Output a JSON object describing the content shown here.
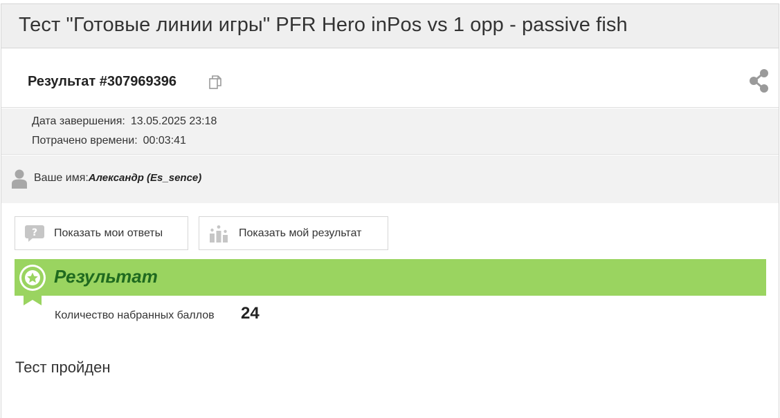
{
  "page": {
    "title": "Тест \"Готовые линии игры\" PFR Hero inPos vs 1 opp - passive fish"
  },
  "result_header": {
    "result_id": "Результат #307969396",
    "copy_icon": "copy-icon",
    "share_icon": "share-icon"
  },
  "meta": {
    "completed_label": "Дата завершения:",
    "completed_value": "13.05.2025 23:18",
    "time_label": "Потрачено времени:",
    "time_value": "00:03:41"
  },
  "user": {
    "icon": "user-icon",
    "label": "Ваше имя:",
    "name": "Александр (Es_sence)"
  },
  "buttons": {
    "show_answers": "Показать мои ответы",
    "show_answers_icon": "question-bubble-icon",
    "show_result": "Показать мой результат",
    "show_result_icon": "podium-icon"
  },
  "result": {
    "title": "Результат",
    "badge_icon": "award-badge-icon",
    "score_label": "Количество набранных баллов",
    "score_value": "24",
    "verdict": "Тест пройден"
  },
  "colors": {
    "title_bar_bg": "#efefef",
    "meta_bg": "#f2f2f2",
    "result_bar_bg": "#9ad460",
    "result_title": "#1f6a1f"
  }
}
